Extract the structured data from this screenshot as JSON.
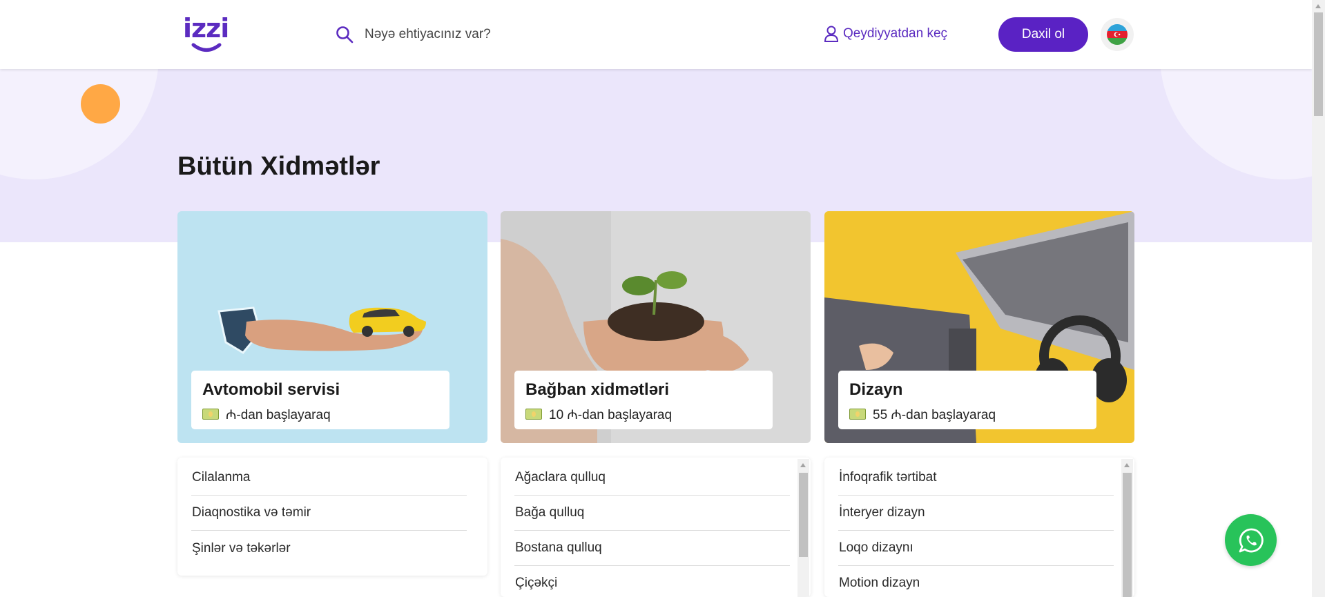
{
  "header": {
    "logo_text": "izzi",
    "search_placeholder": "Nəyə ehtiyacınız var?",
    "register_label": "Qeydiyyatdan keç",
    "login_label": "Daxil ol",
    "language_icon": "azerbaijan-flag-icon"
  },
  "page_title": "Bütün Xidmətlər",
  "cards": [
    {
      "name": "Avtomobil servisi",
      "price": "₼-dan başlayaraq",
      "bg": "#bde3f1"
    },
    {
      "name": "Bağban xidmətləri",
      "price": "10 ₼-dan başlayaraq",
      "bg": "#dcdcdc"
    },
    {
      "name": "Dizayn",
      "price": "55 ₼-dan başlayaraq",
      "bg": "#f2c52f"
    }
  ],
  "lists": [
    {
      "items": [
        "Cilalanma",
        "Diaqnostika və təmir",
        "Şinlər və təkərlər"
      ]
    },
    {
      "items": [
        "Ağaclara qulluq",
        "Bağa qulluq",
        "Bostana qulluq",
        "Çiçəkçi"
      ]
    },
    {
      "items": [
        "İnfoqrafik tərtibat",
        "İnteryer dizayn",
        "Loqo dizaynı",
        "Motion dizayn"
      ]
    }
  ],
  "colors": {
    "brand": "#5a22c4",
    "hero": "#ebe6fb",
    "accent": "#ffa845",
    "whatsapp": "#28c35a"
  },
  "whatsapp_icon": "whatsapp-icon"
}
